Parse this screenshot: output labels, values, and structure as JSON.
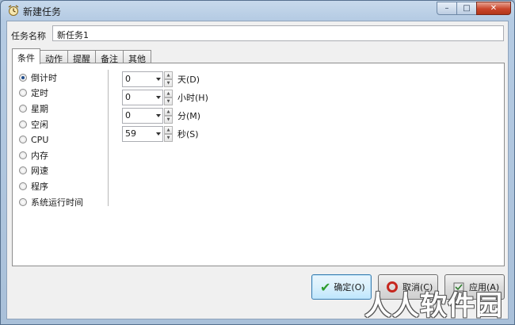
{
  "window": {
    "title": "新建任务",
    "controls": {
      "minimize": "–",
      "maximize": "□",
      "close": "✕"
    }
  },
  "task_name": {
    "label": "任务名称",
    "value": "新任务1"
  },
  "tabs": [
    {
      "label": "条件",
      "active": true
    },
    {
      "label": "动作"
    },
    {
      "label": "提醒"
    },
    {
      "label": "备注"
    },
    {
      "label": "其他"
    }
  ],
  "conditions": [
    {
      "label": "倒计时",
      "checked": true
    },
    {
      "label": "定时"
    },
    {
      "label": "星期"
    },
    {
      "label": "空闲"
    },
    {
      "label": "CPU"
    },
    {
      "label": "内存"
    },
    {
      "label": "网速"
    },
    {
      "label": "程序"
    },
    {
      "label": "系统运行时间"
    }
  ],
  "countdown": [
    {
      "value": "0",
      "unit": "天(D)"
    },
    {
      "value": "0",
      "unit": "小时(H)"
    },
    {
      "value": "0",
      "unit": "分(M)"
    },
    {
      "value": "59",
      "unit": "秒(S)"
    }
  ],
  "buttons": {
    "ok": "确定(O)",
    "cancel": "取消(C)",
    "apply": "应用(A)"
  },
  "watermark": "人人软件园"
}
